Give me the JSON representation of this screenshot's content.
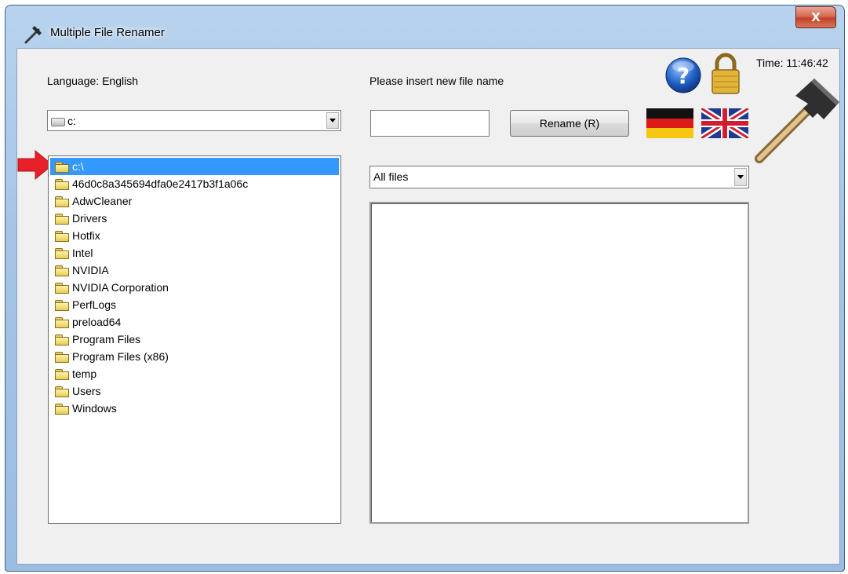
{
  "window": {
    "title": "Multiple File Renamer",
    "close_label": "X"
  },
  "language": {
    "label": "Language: English"
  },
  "drive": {
    "selected": "c:"
  },
  "tree": {
    "selected": "c:\\",
    "items": [
      "46d0c8a345694dfa0e2417b3f1a06c",
      "AdwCleaner",
      "Drivers",
      "Hotfix",
      "Intel",
      "NVIDIA",
      "NVIDIA Corporation",
      "PerfLogs",
      "preload64",
      "Program Files",
      "Program Files (x86)",
      "temp",
      "Users",
      "Windows"
    ]
  },
  "rename": {
    "prompt": "Please insert new file name",
    "input_value": "",
    "button_label": "Rename (R)"
  },
  "filter": {
    "selected": "All files"
  },
  "clock": {
    "text": "Time: 11:46:42"
  },
  "icons": {
    "title": "hammer-icon",
    "help": "help-icon",
    "lock": "lock-icon",
    "flag_de": "german-flag-icon",
    "flag_uk": "uk-flag-icon",
    "hammer": "hammer-icon",
    "pointer": "red-arrow-icon"
  },
  "colors": {
    "selection": "#3399ff",
    "help_blue": "#1f5fc5",
    "pointer_red": "#e8202a"
  }
}
